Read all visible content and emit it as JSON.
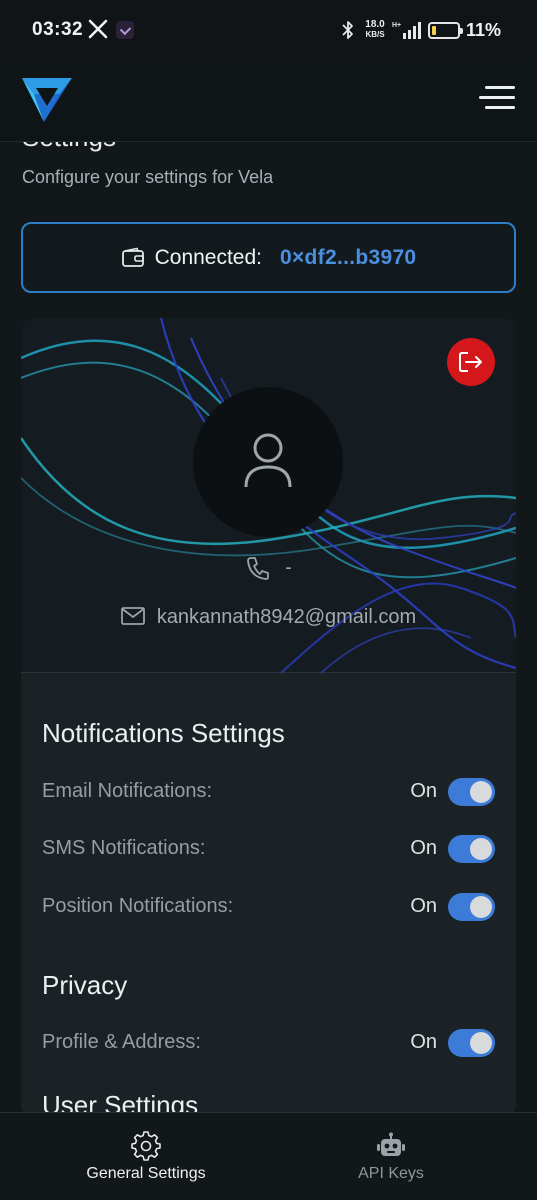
{
  "status_bar": {
    "time": "03:32",
    "speed_value": "18.0",
    "speed_unit": "KB/S",
    "battery_percent": "11%"
  },
  "header": {
    "menu_icon": "hamburger-menu-icon",
    "logo": "vela-logo"
  },
  "page": {
    "partial_title": "Settings",
    "subtitle": "Configure your settings for Vela"
  },
  "wallet": {
    "label": "Connected:",
    "address": "0×df2...b3970"
  },
  "profile": {
    "phone": "-",
    "email": "kankannath8942@gmail.com"
  },
  "notifications": {
    "title": "Notifications Settings",
    "items": [
      {
        "label": "Email Notifications:",
        "state": "On"
      },
      {
        "label": "SMS Notifications:",
        "state": "On"
      },
      {
        "label": "Position Notifications:",
        "state": "On"
      }
    ]
  },
  "privacy": {
    "title": "Privacy",
    "items": [
      {
        "label": "Profile & Address:",
        "state": "On"
      }
    ]
  },
  "user_settings": {
    "title": "User Settings"
  },
  "bottom_nav": {
    "items": [
      {
        "label": "General Settings",
        "icon": "gear-icon",
        "active": true
      },
      {
        "label": "API Keys",
        "icon": "robot-icon",
        "active": false
      }
    ]
  },
  "colors": {
    "accent": "#3d7bd8",
    "address": "#4b8fe0",
    "logout": "#d4171a",
    "background": "#121719"
  }
}
